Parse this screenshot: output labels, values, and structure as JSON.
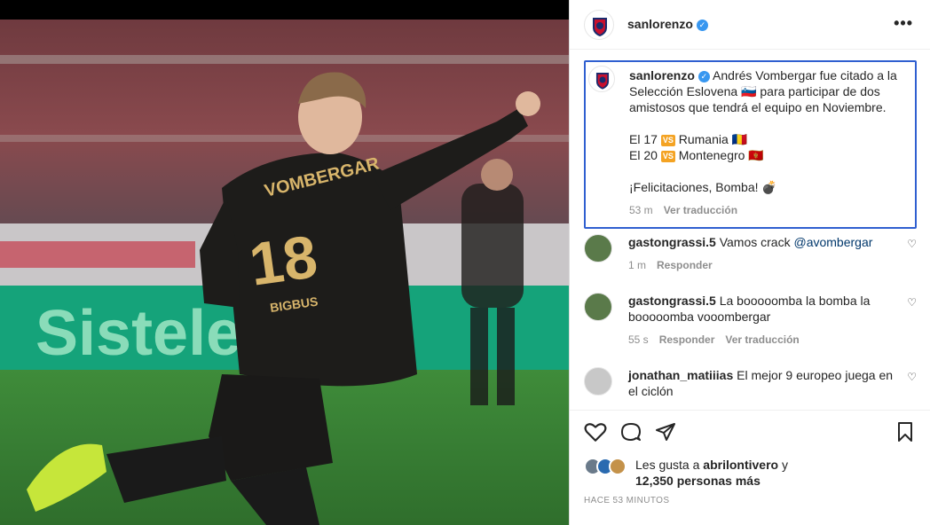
{
  "post": {
    "username": "sanlorenzo",
    "more_icon": "more-horizontal-icon"
  },
  "caption": {
    "username": "sanlorenzo",
    "line1": "Andrés Vombergar fue citado a la Selección Eslovena 🇸🇮 para participar de dos amistosos que tendrá el equipo en Noviembre.",
    "match1_prefix": "El 17",
    "match1_vs": "VS",
    "match1_team": "Rumania",
    "match1_flag": "🇷🇴",
    "match2_prefix": "El 20",
    "match2_vs": "VS",
    "match2_team": "Montenegro",
    "match2_flag": "🇲🇪",
    "closing": "¡Felicitaciones, Bomba! 💣",
    "time": "53 m",
    "translate": "Ver traducción"
  },
  "comments": [
    {
      "username": "gastongrassi.5",
      "text": "Vamos crack ",
      "mention": "@avombergar",
      "time": "1 m",
      "reply": "Responder",
      "translate": ""
    },
    {
      "username": "gastongrassi.5",
      "text": "La booooomba la bomba la booooomba vooombergar",
      "mention": "",
      "time": "55 s",
      "reply": "Responder",
      "translate": "Ver traducción"
    },
    {
      "username": "jonathan_matiiias",
      "text": "El mejor 9 europeo juega en el ciclón",
      "mention": "",
      "time": "",
      "reply": "",
      "translate": ""
    }
  ],
  "likes": {
    "prefix": "Les gusta a ",
    "user": "abrilontivero",
    "suffix": " y",
    "count_text": "12,350 personas más"
  },
  "timestamp": "HACE 53 MINUTOS",
  "photo": {
    "shirt_name": "VOMBERGAR",
    "shirt_number": "18",
    "sponsor": "BIGBUS",
    "banner_text": "Sistelectric"
  },
  "colors": {
    "accent": "#3897f0",
    "highlight_border": "#2f5fd0",
    "club_red": "#c8102e",
    "club_blue": "#1a2a6c"
  }
}
